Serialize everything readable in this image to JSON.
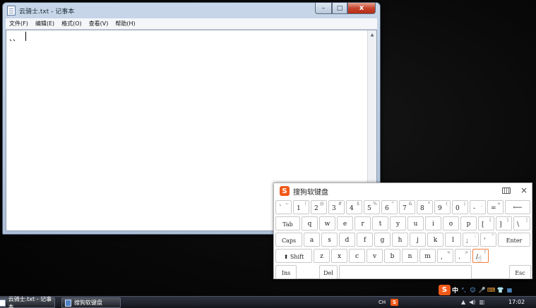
{
  "notepad": {
    "title": "云骑士.txt - 记事本",
    "controls": {
      "minimize": "–",
      "maximize": "□",
      "close": "x"
    },
    "menu": [
      "文件(F)",
      "编辑(E)",
      "格式(O)",
      "查看(V)",
      "帮助(H)"
    ],
    "content": "、、"
  },
  "keyboard": {
    "logo": "S",
    "title": "搜狗软键盘",
    "close": "×",
    "rows": [
      [
        {
          "main": "`",
          "shift": "~"
        },
        {
          "main": "1",
          "shift": "!"
        },
        {
          "main": "2",
          "shift": "@"
        },
        {
          "main": "3",
          "shift": "#"
        },
        {
          "main": "4",
          "shift": "$"
        },
        {
          "main": "5",
          "shift": "%"
        },
        {
          "main": "6",
          "shift": "^"
        },
        {
          "main": "7",
          "shift": "&"
        },
        {
          "main": "8",
          "shift": "*"
        },
        {
          "main": "9",
          "shift": "("
        },
        {
          "main": "0",
          "shift": ")"
        },
        {
          "main": "-",
          "shift": "_"
        },
        {
          "main": "=",
          "shift": "+"
        },
        {
          "main": "⟵",
          "shift": ""
        }
      ],
      [
        {
          "main": "Tab",
          "shift": ""
        },
        {
          "main": "q",
          "shift": ""
        },
        {
          "main": "w",
          "shift": ""
        },
        {
          "main": "e",
          "shift": ""
        },
        {
          "main": "r",
          "shift": ""
        },
        {
          "main": "t",
          "shift": ""
        },
        {
          "main": "y",
          "shift": ""
        },
        {
          "main": "u",
          "shift": ""
        },
        {
          "main": "i",
          "shift": ""
        },
        {
          "main": "o",
          "shift": ""
        },
        {
          "main": "p",
          "shift": ""
        },
        {
          "main": "[",
          "shift": "{"
        },
        {
          "main": "]",
          "shift": "}"
        },
        {
          "main": "\\",
          "shift": "|"
        }
      ],
      [
        {
          "main": "Caps",
          "shift": ""
        },
        {
          "main": "a",
          "shift": ""
        },
        {
          "main": "s",
          "shift": ""
        },
        {
          "main": "d",
          "shift": ""
        },
        {
          "main": "f",
          "shift": ""
        },
        {
          "main": "g",
          "shift": ""
        },
        {
          "main": "h",
          "shift": ""
        },
        {
          "main": "j",
          "shift": ""
        },
        {
          "main": "k",
          "shift": ""
        },
        {
          "main": "l",
          "shift": ""
        },
        {
          "main": ";",
          "shift": ":"
        },
        {
          "main": "'",
          "shift": "\""
        },
        {
          "main": "Enter",
          "shift": ""
        }
      ],
      [
        {
          "main": "⬆ Shift",
          "shift": ""
        },
        {
          "main": "z",
          "shift": ""
        },
        {
          "main": "x",
          "shift": ""
        },
        {
          "main": "c",
          "shift": ""
        },
        {
          "main": "v",
          "shift": ""
        },
        {
          "main": "b",
          "shift": ""
        },
        {
          "main": "n",
          "shift": ""
        },
        {
          "main": "m",
          "shift": ""
        },
        {
          "main": ",",
          "shift": "<"
        },
        {
          "main": ".",
          "shift": ">"
        },
        {
          "main": "/",
          "shift": "?"
        }
      ],
      [
        {
          "main": "Ins",
          "shift": ""
        },
        {
          "main": "Del",
          "shift": ""
        },
        {
          "main": "",
          "shift": ""
        },
        {
          "main": "Esc",
          "shift": ""
        }
      ]
    ]
  },
  "ime_bar": {
    "logo": "S",
    "mode": "中",
    "punct": "°,",
    "emoji": "☺",
    "mic": "🎤",
    "keyboard": "⌨",
    "skin": "👕",
    "tools": "▦"
  },
  "taskbar": {
    "items": [
      {
        "label": "云骑士.txt - 记事本"
      },
      {
        "label": "搜狗软键盘"
      }
    ],
    "lang": "CH",
    "ime": "S",
    "clock": "17:02"
  },
  "colors": {
    "sogou_orange": "#f25a1a",
    "active_key_border": "#f07a3c"
  }
}
